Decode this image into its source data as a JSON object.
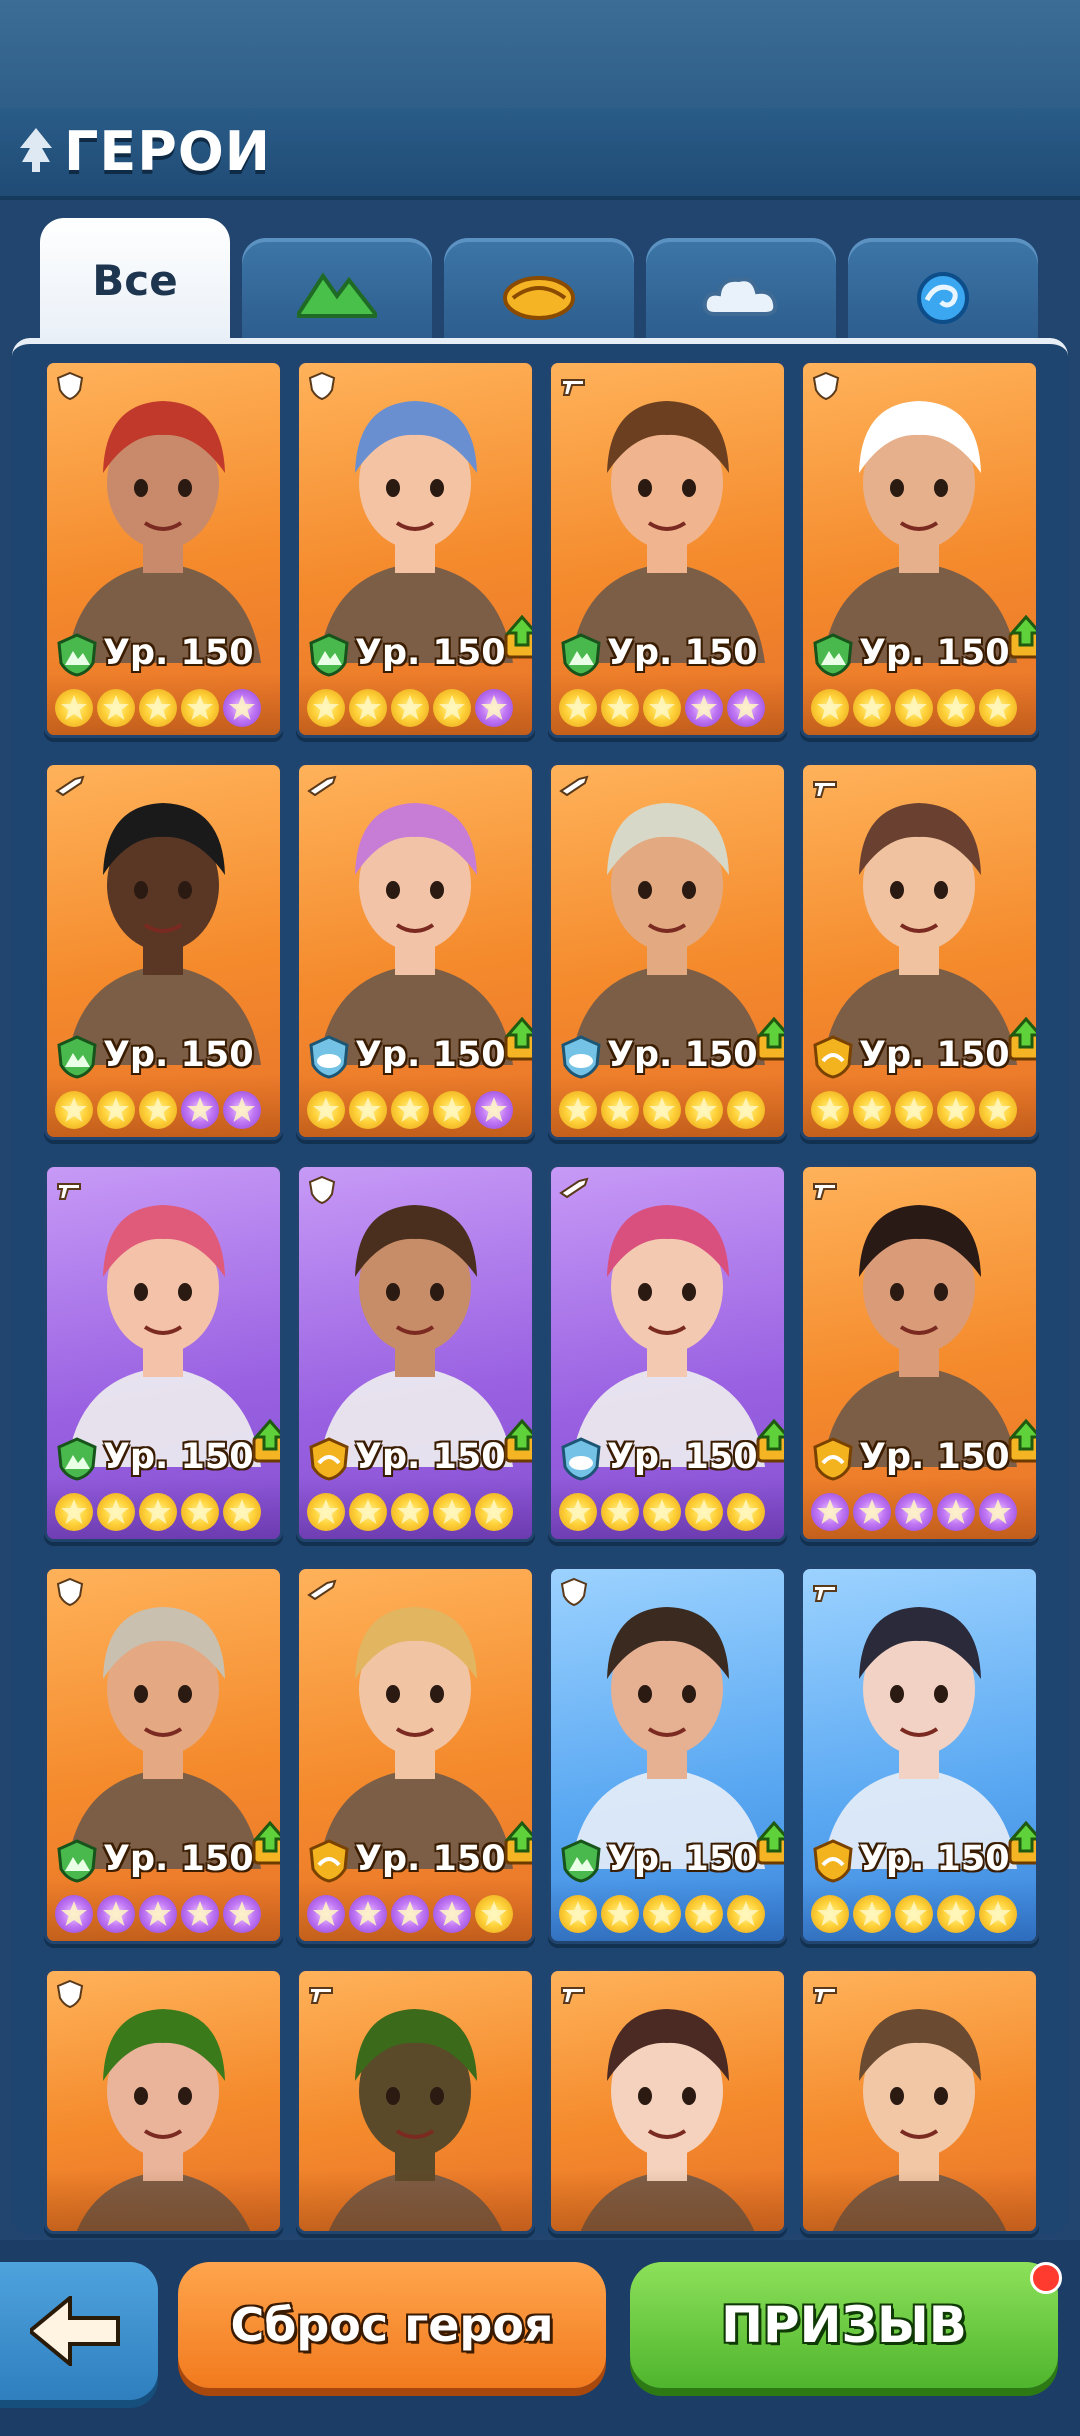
{
  "header": {
    "title": "ГЕРОИ"
  },
  "tabs": [
    {
      "label": "Все",
      "icon": "all-label",
      "active": true
    },
    {
      "label": "",
      "icon": "mountain-icon",
      "active": false
    },
    {
      "label": "",
      "icon": "sun-icon",
      "active": false
    },
    {
      "label": "",
      "icon": "cloud-icon",
      "active": false
    },
    {
      "label": "",
      "icon": "wave-icon",
      "active": false
    }
  ],
  "heroes": [
    {
      "level": "Ур. 150",
      "bg": "orange",
      "faction": "mountain",
      "role": "shield",
      "upgrade": false,
      "stars": [
        "gold",
        "gold",
        "gold",
        "gold",
        "purple"
      ]
    },
    {
      "level": "Ур. 150",
      "bg": "orange",
      "faction": "mountain",
      "role": "shield",
      "upgrade": true,
      "stars": [
        "gold",
        "gold",
        "gold",
        "gold",
        "purple"
      ]
    },
    {
      "level": "Ур. 150",
      "bg": "orange",
      "faction": "mountain",
      "role": "gun",
      "upgrade": false,
      "stars": [
        "gold",
        "gold",
        "gold",
        "purple",
        "purple"
      ]
    },
    {
      "level": "Ур. 150",
      "bg": "orange",
      "faction": "mountain",
      "role": "shield",
      "upgrade": true,
      "stars": [
        "gold",
        "gold",
        "gold",
        "gold",
        "gold"
      ]
    },
    {
      "level": "Ур. 150",
      "bg": "orange",
      "faction": "mountain",
      "role": "rifle",
      "upgrade": false,
      "stars": [
        "gold",
        "gold",
        "gold",
        "purple",
        "purple"
      ]
    },
    {
      "level": "Ур. 150",
      "bg": "orange",
      "faction": "cloud",
      "role": "rifle",
      "upgrade": true,
      "stars": [
        "gold",
        "gold",
        "gold",
        "gold",
        "purple"
      ]
    },
    {
      "level": "Ур. 150",
      "bg": "orange",
      "faction": "cloud",
      "role": "rifle",
      "upgrade": true,
      "stars": [
        "gold",
        "gold",
        "gold",
        "gold",
        "gold"
      ]
    },
    {
      "level": "Ур. 150",
      "bg": "orange",
      "faction": "sun",
      "role": "gun",
      "upgrade": true,
      "stars": [
        "gold",
        "gold",
        "gold",
        "gold",
        "gold"
      ]
    },
    {
      "level": "Ур. 150",
      "bg": "purple",
      "faction": "mountain",
      "role": "gun",
      "upgrade": true,
      "stars": [
        "gold",
        "gold",
        "gold",
        "gold",
        "gold"
      ]
    },
    {
      "level": "Ур. 150",
      "bg": "purple",
      "faction": "sun",
      "role": "shield",
      "upgrade": true,
      "stars": [
        "gold",
        "gold",
        "gold",
        "gold",
        "gold"
      ]
    },
    {
      "level": "Ур. 150",
      "bg": "purple",
      "faction": "cloud",
      "role": "rifle",
      "upgrade": true,
      "stars": [
        "gold",
        "gold",
        "gold",
        "gold",
        "gold"
      ]
    },
    {
      "level": "Ур. 150",
      "bg": "orange",
      "faction": "sun",
      "role": "gun",
      "upgrade": true,
      "stars": [
        "purple",
        "purple",
        "purple",
        "purple",
        "purple"
      ]
    },
    {
      "level": "Ур. 150",
      "bg": "orange",
      "faction": "mountain",
      "role": "shield",
      "upgrade": true,
      "stars": [
        "purple",
        "purple",
        "purple",
        "purple",
        "purple"
      ]
    },
    {
      "level": "Ур. 150",
      "bg": "orange",
      "faction": "sun",
      "role": "rifle",
      "upgrade": true,
      "stars": [
        "purple",
        "purple",
        "purple",
        "purple",
        "gold"
      ]
    },
    {
      "level": "Ур. 150",
      "bg": "blue",
      "faction": "mountain",
      "role": "shield",
      "upgrade": true,
      "stars": [
        "gold",
        "gold",
        "gold",
        "gold",
        "gold"
      ]
    },
    {
      "level": "Ур. 150",
      "bg": "blue",
      "faction": "sun",
      "role": "gun",
      "upgrade": true,
      "stars": [
        "gold",
        "gold",
        "gold",
        "gold",
        "gold"
      ]
    },
    {
      "level": "",
      "bg": "orange",
      "faction": "",
      "role": "shield",
      "upgrade": false,
      "stars": []
    },
    {
      "level": "",
      "bg": "orange",
      "faction": "",
      "role": "gun",
      "upgrade": false,
      "stars": []
    },
    {
      "level": "",
      "bg": "orange",
      "faction": "",
      "role": "gun",
      "upgrade": false,
      "stars": []
    },
    {
      "level": "",
      "bg": "orange",
      "faction": "",
      "role": "gun",
      "upgrade": false,
      "stars": []
    }
  ],
  "buttons": {
    "back": "arrow-left-icon",
    "reset_label": "Сброс героя",
    "summon_label": "ПРИЗЫВ"
  },
  "colors": {
    "accent": "#f48a2c",
    "green": "#4fb52d",
    "bg": "#22456f"
  }
}
